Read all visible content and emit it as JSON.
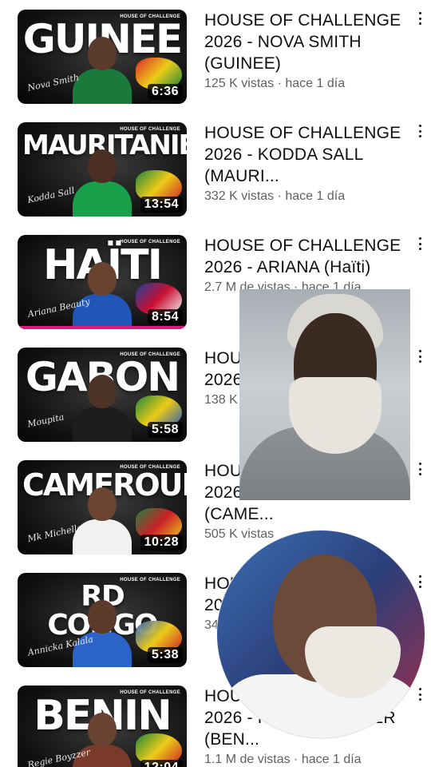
{
  "thumb_tag": "HOUSE OF CHALLENGE",
  "colors": {
    "accent_progress": "#e0177e",
    "meta_gray": "#606060"
  },
  "videos": [
    {
      "country_text": "GUINEE",
      "signature": "Nova Smith",
      "duration": "6:36",
      "title": "HOUSE OF CHALLENGE 2026 - NOVA SMITH (GUINEE)",
      "views": "125 K vistas",
      "age": "hace 1 día"
    },
    {
      "country_text": "MAURITANIE",
      "signature": "Kodda Sall",
      "duration": "13:54",
      "title": "HOUSE OF CHALLENGE 2026 - KODDA SALL (MAURI...",
      "views": "332 K vistas",
      "age": "hace 1 día"
    },
    {
      "country_text": "HAÏTI",
      "signature": "Ariana Beauty",
      "duration": "8:54",
      "title": "HOUSE OF CHALLENGE 2026 - ARIANA (Haïti)",
      "views": "2.7 M de vistas",
      "age": "hace 1 día",
      "watched_fraction": 1.0
    },
    {
      "country_text": "GABON",
      "signature": "Moupita",
      "duration": "5:58",
      "title": "HOUSE OF CHALLENGE 2026 - MOUPITA",
      "views": "138 K",
      "age": ""
    },
    {
      "country_text": "CAMEROUN",
      "signature": "Mk Michelle",
      "duration": "10:28",
      "title": "HOUSE OF CHALLENGE 2026 - MK MICHELLE (CAME...",
      "views": "505 K vistas",
      "age": ""
    },
    {
      "country_text": "RD CONGO",
      "signature": "Annicka Kalala",
      "duration": "5:38",
      "title": "HOUSE OF CHALLENGE 2026 - A",
      "views": "34",
      "age": ""
    },
    {
      "country_text": "BENIN",
      "signature": "Regie Boyzzer",
      "duration": "12:04",
      "title": "HOUSE OF CHALLENGE 2026 - REGIE BOYZZER (BEN...",
      "views": "1.1 M de vistas",
      "age": "hace 1 día"
    }
  ]
}
